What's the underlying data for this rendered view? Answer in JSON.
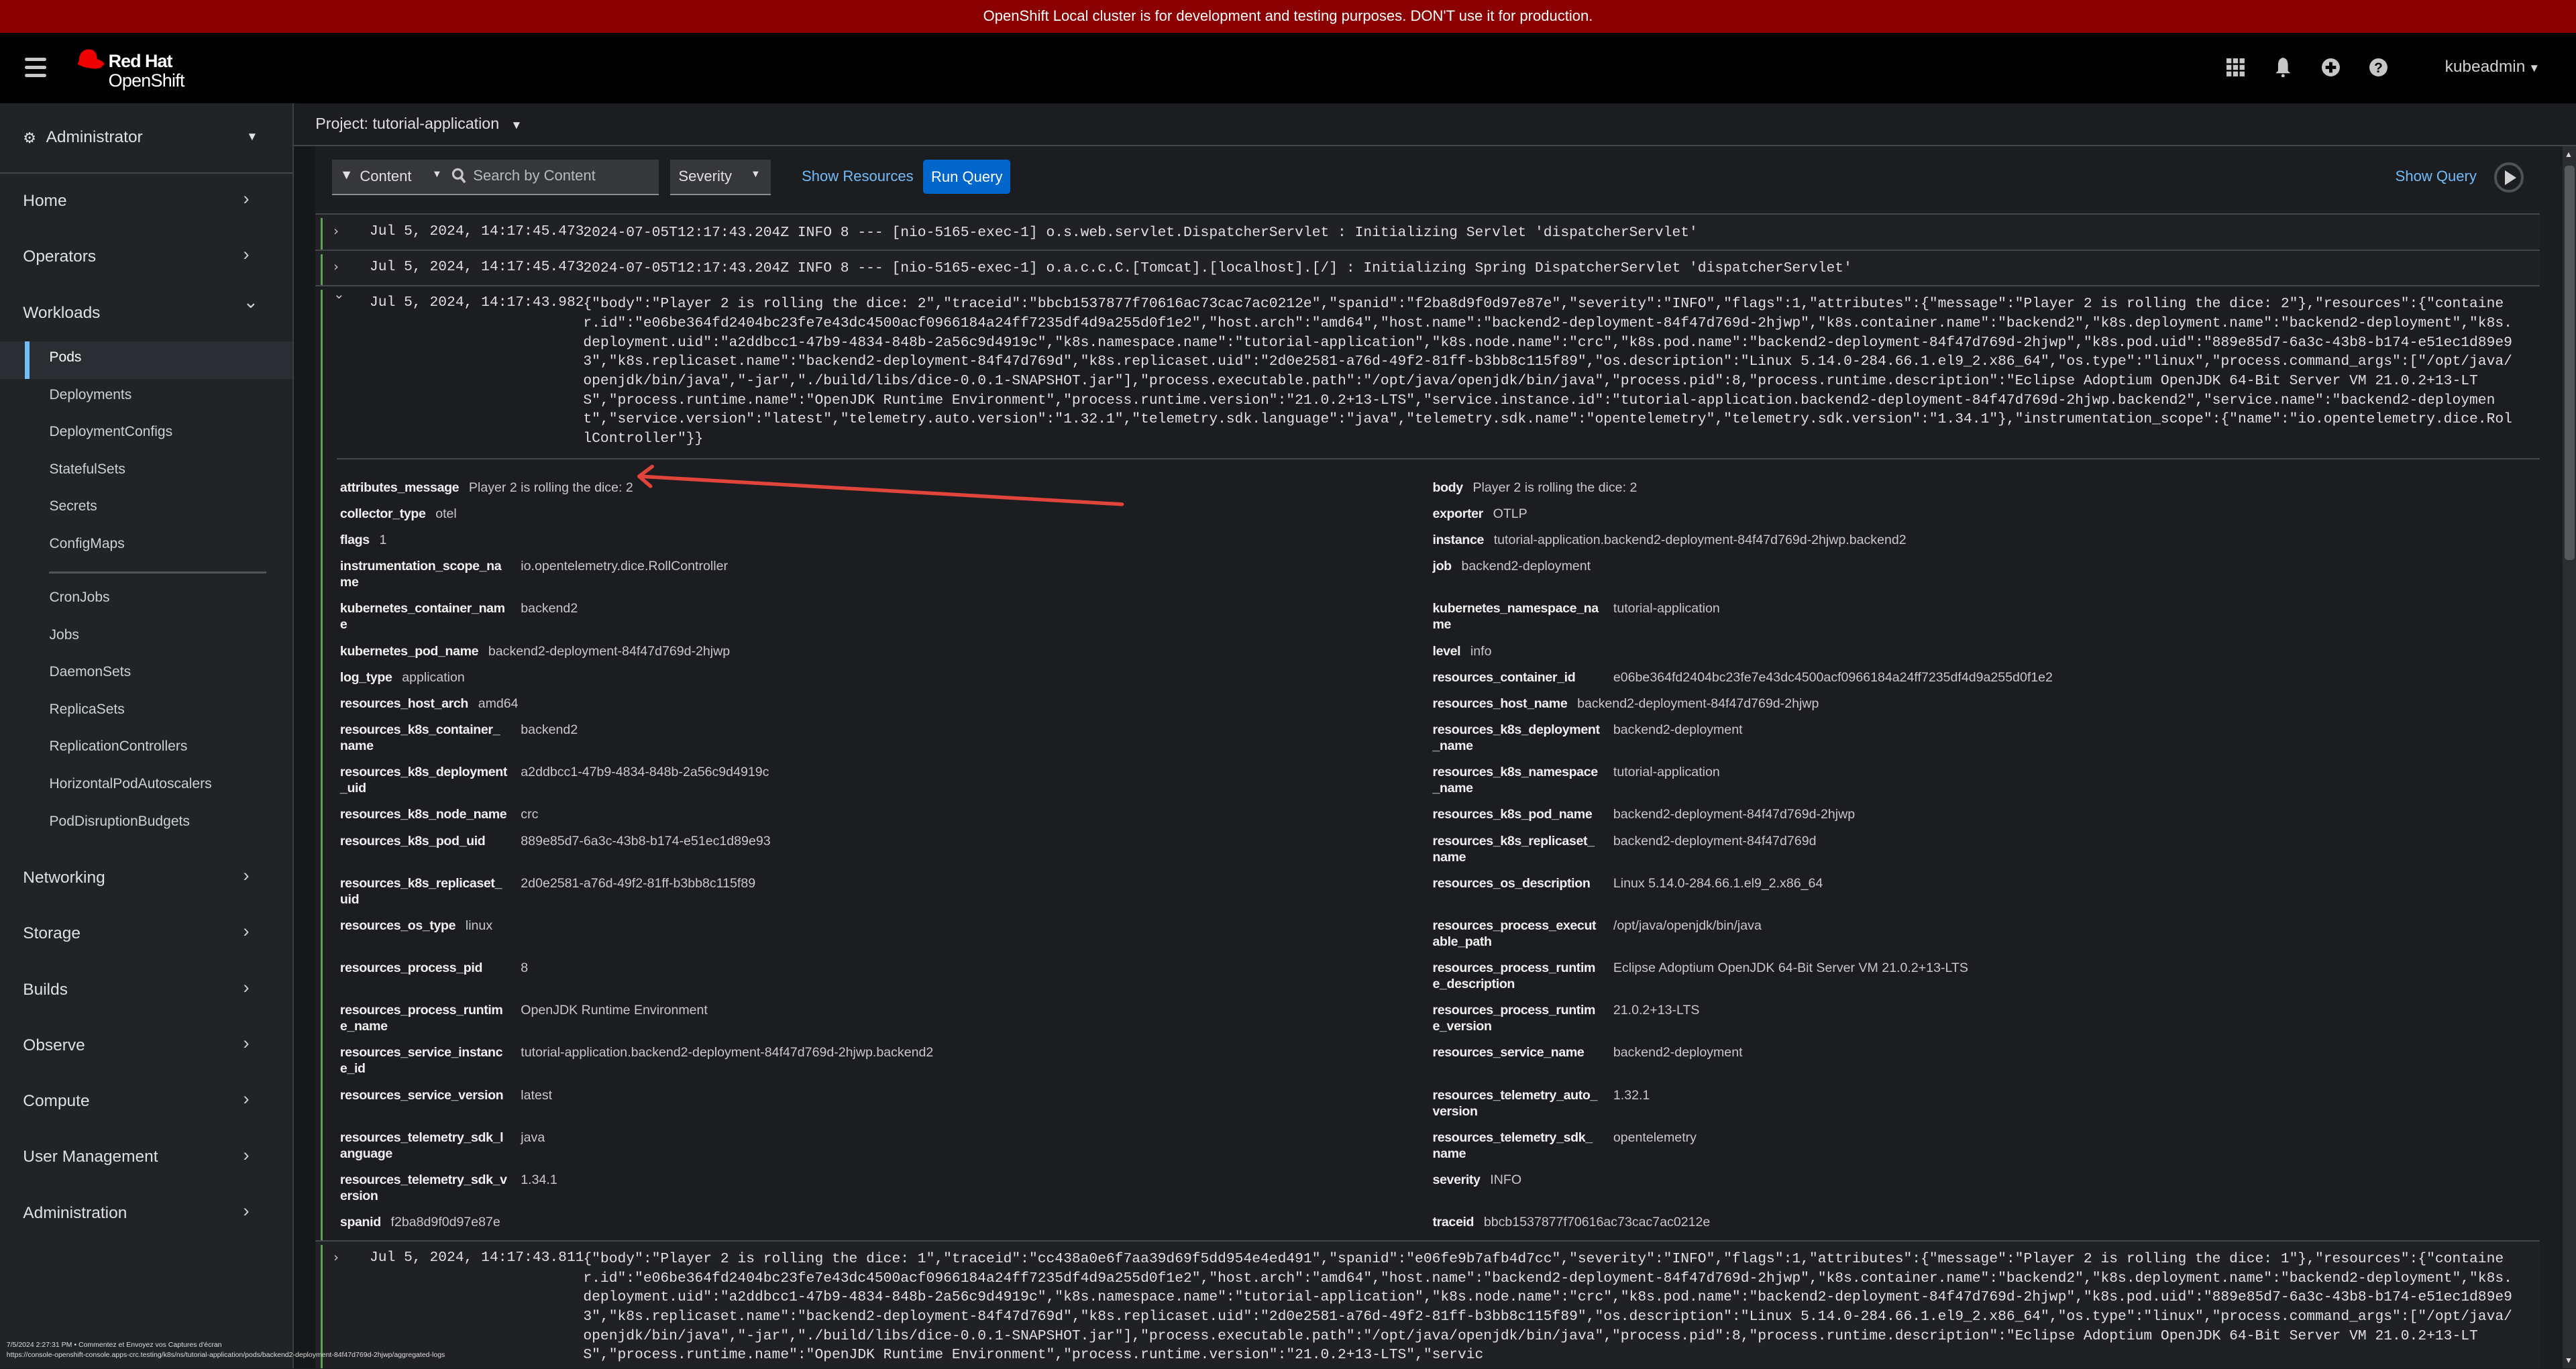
{
  "banner": "OpenShift Local cluster is for development and testing purposes. DON'T use it for production.",
  "masthead": {
    "brand_line1": "Red Hat",
    "brand_line2": "OpenShift",
    "icons": [
      "grid-icon",
      "bell-icon",
      "plus-circle-icon",
      "help-icon"
    ],
    "user": "kubeadmin"
  },
  "sidebar": {
    "perspective": "Administrator",
    "nav": [
      {
        "type": "section",
        "label": "Home",
        "expanded": false
      },
      {
        "type": "section",
        "label": "Operators",
        "expanded": false
      },
      {
        "type": "section",
        "label": "Workloads",
        "expanded": true
      },
      {
        "type": "item",
        "label": "Pods",
        "active": true
      },
      {
        "type": "item",
        "label": "Deployments"
      },
      {
        "type": "item",
        "label": "DeploymentConfigs"
      },
      {
        "type": "item",
        "label": "StatefulSets"
      },
      {
        "type": "item",
        "label": "Secrets"
      },
      {
        "type": "item",
        "label": "ConfigMaps"
      },
      {
        "type": "divider"
      },
      {
        "type": "item",
        "label": "CronJobs"
      },
      {
        "type": "item",
        "label": "Jobs"
      },
      {
        "type": "item",
        "label": "DaemonSets"
      },
      {
        "type": "item",
        "label": "ReplicaSets"
      },
      {
        "type": "item",
        "label": "ReplicationControllers"
      },
      {
        "type": "item",
        "label": "HorizontalPodAutoscalers"
      },
      {
        "type": "item",
        "label": "PodDisruptionBudgets"
      },
      {
        "type": "gap"
      },
      {
        "type": "section",
        "label": "Networking",
        "expanded": false
      },
      {
        "type": "section",
        "label": "Storage",
        "expanded": false
      },
      {
        "type": "section",
        "label": "Builds",
        "expanded": false
      },
      {
        "type": "section",
        "label": "Observe",
        "expanded": false
      },
      {
        "type": "section",
        "label": "Compute",
        "expanded": false
      },
      {
        "type": "section",
        "label": "User Management",
        "expanded": false
      },
      {
        "type": "section",
        "label": "Administration",
        "expanded": false
      }
    ]
  },
  "project": "Project: tutorial-application",
  "toolbar": {
    "content_label": "Content",
    "search_placeholder": "Search by Content",
    "search_value": "",
    "severity_label": "Severity",
    "show_resources": "Show Resources",
    "run_query": "Run Query",
    "show_query": "Show Query"
  },
  "logs": [
    {
      "timestamp": "Jul 5, 2024, 14:17:45.473",
      "expanded": false,
      "message": "2024-07-05T12:17:43.204Z INFO 8 --- [nio-5165-exec-1] o.s.web.servlet.DispatcherServlet : Initializing Servlet 'dispatcherServlet'"
    },
    {
      "timestamp": "Jul 5, 2024, 14:17:45.473",
      "expanded": false,
      "message": "2024-07-05T12:17:43.204Z INFO 8 --- [nio-5165-exec-1] o.a.c.c.C.[Tomcat].[localhost].[/] : Initializing Spring DispatcherServlet 'dispatcherServlet'"
    },
    {
      "timestamp": "Jul 5, 2024, 14:17:43.982",
      "expanded": true,
      "message": "{\"body\":\"Player 2 is rolling the dice: 2\",\"traceid\":\"bbcb1537877f70616ac73cac7ac0212e\",\"spanid\":\"f2ba8d9f0d97e87e\",\"severity\":\"INFO\",\"flags\":1,\"attributes\":{\"message\":\"Player 2 is rolling the dice: 2\"},\"resources\":{\"container.id\":\"e06be364fd2404bc23fe7e43dc4500acf0966184a24ff7235df4d9a255d0f1e2\",\"host.arch\":\"amd64\",\"host.name\":\"backend2-deployment-84f47d769d-2hjwp\",\"k8s.container.name\":\"backend2\",\"k8s.deployment.name\":\"backend2-deployment\",\"k8s.deployment.uid\":\"a2ddbcc1-47b9-4834-848b-2a56c9d4919c\",\"k8s.namespace.name\":\"tutorial-application\",\"k8s.node.name\":\"crc\",\"k8s.pod.name\":\"backend2-deployment-84f47d769d-2hjwp\",\"k8s.pod.uid\":\"889e85d7-6a3c-43b8-b174-e51ec1d89e93\",\"k8s.replicaset.name\":\"backend2-deployment-84f47d769d\",\"k8s.replicaset.uid\":\"2d0e2581-a76d-49f2-81ff-b3bb8c115f89\",\"os.description\":\"Linux 5.14.0-284.66.1.el9_2.x86_64\",\"os.type\":\"linux\",\"process.command_args\":[\"/opt/java/openjdk/bin/java\",\"-jar\",\"./build/libs/dice-0.0.1-SNAPSHOT.jar\"],\"process.executable.path\":\"/opt/java/openjdk/bin/java\",\"process.pid\":8,\"process.runtime.description\":\"Eclipse Adoptium OpenJDK 64-Bit Server VM 21.0.2+13-LTS\",\"process.runtime.name\":\"OpenJDK Runtime Environment\",\"process.runtime.version\":\"21.0.2+13-LTS\",\"service.instance.id\":\"tutorial-application.backend2-deployment-84f47d769d-2hjwp.backend2\",\"service.name\":\"backend2-deployment\",\"service.version\":\"latest\",\"telemetry.auto.version\":\"1.32.1\",\"telemetry.sdk.language\":\"java\",\"telemetry.sdk.name\":\"opentelemetry\",\"telemetry.sdk.version\":\"1.34.1\"},\"instrumentation_scope\":{\"name\":\"io.opentelemetry.dice.RollController\"}}",
      "details": [
        [
          "attributes_message",
          "Player 2 is rolling the dice: 2"
        ],
        [
          "body",
          "Player 2 is rolling the dice: 2"
        ],
        [
          "collector_type",
          "otel"
        ],
        [
          "exporter",
          "OTLP"
        ],
        [
          "flags",
          "1"
        ],
        [
          "instance",
          "tutorial-application.backend2-deployment-84f47d769d-2hjwp.backend2"
        ],
        [
          "instrumentation_scope_name",
          "io.opentelemetry.dice.RollController"
        ],
        [
          "job",
          "backend2-deployment"
        ],
        [
          "kubernetes_container_name",
          "backend2"
        ],
        [
          "kubernetes_namespace_name",
          "tutorial-application"
        ],
        [
          "kubernetes_pod_name",
          "backend2-deployment-84f47d769d-2hjwp"
        ],
        [
          "level",
          "info"
        ],
        [
          "log_type",
          "application"
        ],
        [
          "resources_container_id",
          "e06be364fd2404bc23fe7e43dc4500acf0966184a24ff7235df4d9a255d0f1e2"
        ],
        [
          "resources_host_arch",
          "amd64"
        ],
        [
          "resources_host_name",
          "backend2-deployment-84f47d769d-2hjwp"
        ],
        [
          "resources_k8s_container_name",
          "backend2"
        ],
        [
          "resources_k8s_deployment_name",
          "backend2-deployment"
        ],
        [
          "resources_k8s_deployment_uid",
          "a2ddbcc1-47b9-4834-848b-2a56c9d4919c"
        ],
        [
          "resources_k8s_namespace_name",
          "tutorial-application"
        ],
        [
          "resources_k8s_node_name",
          "crc"
        ],
        [
          "resources_k8s_pod_name",
          "backend2-deployment-84f47d769d-2hjwp"
        ],
        [
          "resources_k8s_pod_uid",
          "889e85d7-6a3c-43b8-b174-e51ec1d89e93"
        ],
        [
          "resources_k8s_replicaset_name",
          "backend2-deployment-84f47d769d"
        ],
        [
          "resources_k8s_replicaset_uid",
          "2d0e2581-a76d-49f2-81ff-b3bb8c115f89"
        ],
        [
          "resources_os_description",
          "Linux 5.14.0-284.66.1.el9_2.x86_64"
        ],
        [
          "resources_os_type",
          "linux"
        ],
        [
          "resources_process_executable_path",
          "/opt/java/openjdk/bin/java"
        ],
        [
          "resources_process_pid",
          "8"
        ],
        [
          "resources_process_runtime_description",
          "Eclipse Adoptium OpenJDK 64-Bit Server VM 21.0.2+13-LTS"
        ],
        [
          "resources_process_runtime_name",
          "OpenJDK Runtime Environment"
        ],
        [
          "resources_process_runtime_version",
          "21.0.2+13-LTS"
        ],
        [
          "resources_service_instance_id",
          "tutorial-application.backend2-deployment-84f47d769d-2hjwp.backend2"
        ],
        [
          "resources_service_name",
          "backend2-deployment"
        ],
        [
          "resources_service_version",
          "latest"
        ],
        [
          "resources_telemetry_auto_version",
          "1.32.1"
        ],
        [
          "resources_telemetry_sdk_language",
          "java"
        ],
        [
          "resources_telemetry_sdk_name",
          "opentelemetry"
        ],
        [
          "resources_telemetry_sdk_version",
          "1.34.1"
        ],
        [
          "severity",
          "INFO"
        ],
        [
          "spanid",
          "f2ba8d9f0d97e87e"
        ],
        [
          "traceid",
          "bbcb1537877f70616ac73cac7ac0212e"
        ]
      ]
    },
    {
      "timestamp": "Jul 5, 2024, 14:17:43.811",
      "expanded": false,
      "message": "{\"body\":\"Player 2 is rolling the dice: 1\",\"traceid\":\"cc438a0e6f7aa39d69f5dd954e4ed491\",\"spanid\":\"e06fe9b7afb4d7cc\",\"severity\":\"INFO\",\"flags\":1,\"attributes\":{\"message\":\"Player 2 is rolling the dice: 1\"},\"resources\":{\"container.id\":\"e06be364fd2404bc23fe7e43dc4500acf0966184a24ff7235df4d9a255d0f1e2\",\"host.arch\":\"amd64\",\"host.name\":\"backend2-deployment-84f47d769d-2hjwp\",\"k8s.container.name\":\"backend2\",\"k8s.deployment.name\":\"backend2-deployment\",\"k8s.deployment.uid\":\"a2ddbcc1-47b9-4834-848b-2a56c9d4919c\",\"k8s.namespace.name\":\"tutorial-application\",\"k8s.node.name\":\"crc\",\"k8s.pod.name\":\"backend2-deployment-84f47d769d-2hjwp\",\"k8s.pod.uid\":\"889e85d7-6a3c-43b8-b174-e51ec1d89e93\",\"k8s.replicaset.name\":\"backend2-deployment-84f47d769d\",\"k8s.replicaset.uid\":\"2d0e2581-a76d-49f2-81ff-b3bb8c115f89\",\"os.description\":\"Linux 5.14.0-284.66.1.el9_2.x86_64\",\"os.type\":\"linux\",\"process.command_args\":[\"/opt/java/openjdk/bin/java\",\"-jar\",\"./build/libs/dice-0.0.1-SNAPSHOT.jar\"],\"process.executable.path\":\"/opt/java/openjdk/bin/java\",\"process.pid\":8,\"process.runtime.description\":\"Eclipse Adoptium OpenJDK 64-Bit Server VM 21.0.2+13-LTS\",\"process.runtime.name\":\"OpenJDK Runtime Environment\",\"process.runtime.version\":\"21.0.2+13-LTS\",\"servic"
    }
  ],
  "screenshot_overlay": {
    "caption": "7/5/2024 2:27:31 PM • Commentez et Envoyez vos Captures d'écran",
    "url": "https://console-openshift-console.apps-crc.testing/k8s/ns/tutorial-application/pods/backend2-deployment-84f47d769d-2hjwp/aggregated-logs"
  },
  "colors": {
    "banner": "#8b0000",
    "accent": "#0066cc",
    "link": "#73bcf7",
    "log_bar": "#5ba352",
    "annotation_arrow": "#e0443a"
  }
}
